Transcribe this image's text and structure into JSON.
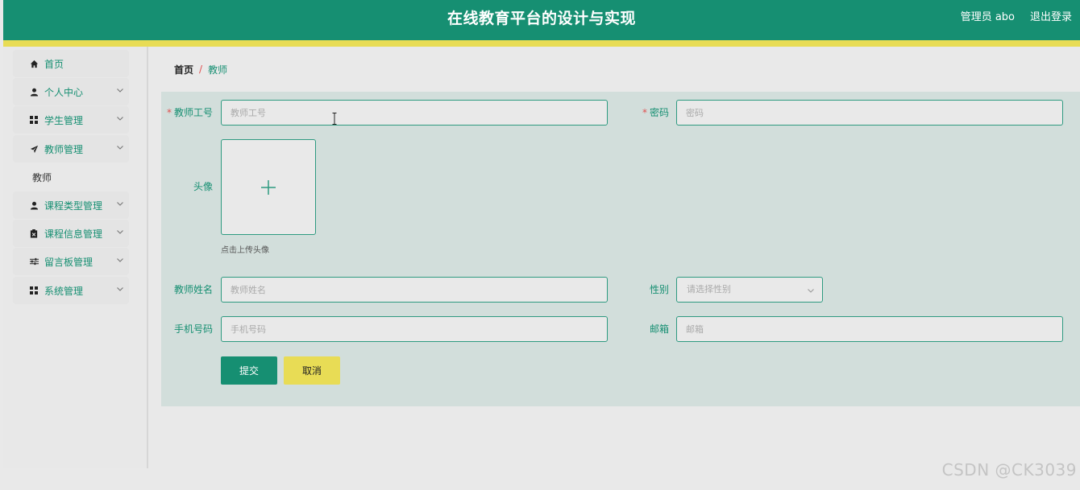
{
  "header": {
    "title": "在线教育平台的设计与实现",
    "user": "管理员 abo",
    "logout": "退出登录",
    "brand_color": "#168f72",
    "stripe_color": "#e8dc55"
  },
  "sidebar": {
    "items": [
      {
        "label": "首页",
        "icon": "home-icon"
      },
      {
        "label": "个人中心",
        "icon": "user-icon"
      },
      {
        "label": "学生管理",
        "icon": "grid-icon"
      },
      {
        "label": "教师管理",
        "icon": "send-icon"
      },
      {
        "label": "课程类型管理",
        "icon": "user-icon"
      },
      {
        "label": "课程信息管理",
        "icon": "clipboard-icon"
      },
      {
        "label": "留言板管理",
        "icon": "sliders-icon"
      },
      {
        "label": "系统管理",
        "icon": "grid-icon"
      }
    ],
    "submenu": {
      "label": "教师"
    }
  },
  "breadcrumb": {
    "home": "首页",
    "separator": "/",
    "current": "教师"
  },
  "form": {
    "teacher_id": {
      "label": "教师工号",
      "placeholder": "教师工号"
    },
    "password": {
      "label": "密码",
      "placeholder": "密码"
    },
    "avatar": {
      "label": "头像",
      "hint": "点击上传头像"
    },
    "name": {
      "label": "教师姓名",
      "placeholder": "教师姓名"
    },
    "gender": {
      "label": "性别",
      "placeholder": "请选择性别"
    },
    "phone": {
      "label": "手机号码",
      "placeholder": "手机号码"
    },
    "email": {
      "label": "邮箱",
      "placeholder": "邮箱"
    },
    "required_mark": "*",
    "submit": "提交",
    "cancel": "取消"
  },
  "watermark": "CSDN @CK3039"
}
